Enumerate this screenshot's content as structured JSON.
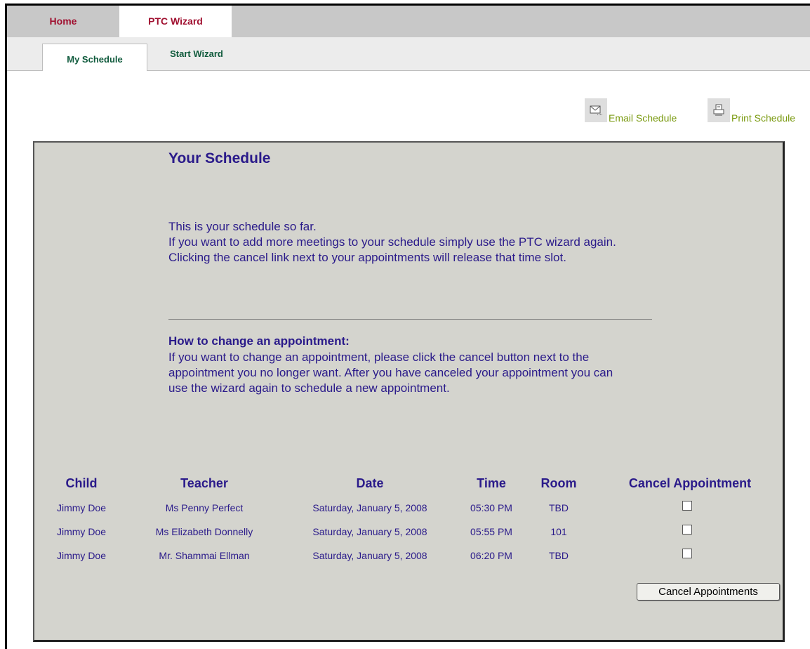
{
  "nav": {
    "top_tabs": [
      {
        "label": "Home",
        "active": false
      },
      {
        "label": "PTC Wizard",
        "active": true
      }
    ],
    "sub_tabs": [
      {
        "label": "My Schedule",
        "active": true
      },
      {
        "label": "Start Wizard",
        "active": false
      }
    ]
  },
  "actions": {
    "email_label": "Email Schedule",
    "print_label": "Print Schedule"
  },
  "panel": {
    "title": "Your Schedule",
    "intro": [
      "This is your schedule so far.",
      "If you want to add more meetings to your schedule simply use the PTC wizard again.",
      "Clicking the cancel link next to your appointments will release that time slot."
    ],
    "how_heading": "How to change an appointment:",
    "how_text": "If you want to change an appointment, please click the cancel button next to the appointment you no longer want. After you have canceled your appointment you can use the wizard again to schedule a new appointment."
  },
  "schedule": {
    "headers": [
      "Child",
      "Teacher",
      "Date",
      "Time",
      "Room",
      "Cancel Appointment"
    ],
    "rows": [
      {
        "child": "Jimmy Doe",
        "teacher": "Ms Penny Perfect",
        "date": "Saturday, January 5, 2008",
        "time": "05:30 PM",
        "room": "TBD",
        "cancel": false
      },
      {
        "child": "Jimmy Doe",
        "teacher": "Ms Elizabeth Donnelly",
        "date": "Saturday, January 5, 2008",
        "time": "05:55 PM",
        "room": "101",
        "cancel": false
      },
      {
        "child": "Jimmy Doe",
        "teacher": "Mr. Shammai Ellman",
        "date": "Saturday, January 5, 2008",
        "time": "06:20 PM",
        "room": "TBD",
        "cancel": false
      }
    ],
    "cancel_button_label": "Cancel Appointments"
  },
  "colors": {
    "text_primary": "#2a1a8a",
    "top_tab_text": "#a01030",
    "sub_tab_text": "#0f5a3c",
    "action_link": "#7a9a10",
    "panel_bg": "#d4d4ce"
  }
}
